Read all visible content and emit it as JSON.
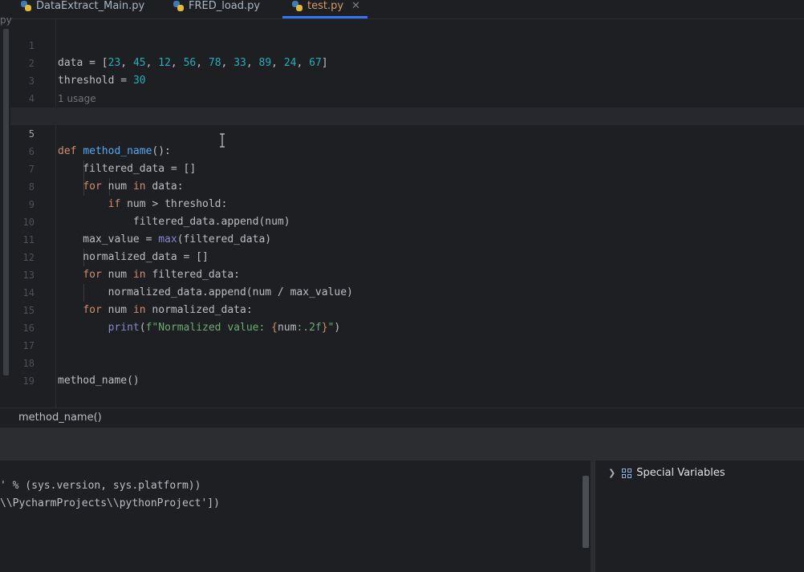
{
  "tabs": [
    {
      "label": "DataExtract_Main.py",
      "active": false
    },
    {
      "label": "FRED_load.py",
      "active": false
    },
    {
      "label": "test.py",
      "active": true
    }
  ],
  "sidebar_fragment": "py",
  "editor": {
    "usage_hint": "1 usage",
    "current_line": 5,
    "line_numbers": [
      "1",
      "2",
      "3",
      "4",
      "5",
      "6",
      "7",
      "8",
      "9",
      "10",
      "11",
      "12",
      "13",
      "14",
      "15",
      "16",
      "17",
      "18",
      "19"
    ]
  },
  "code": {
    "l1": [
      "data",
      " = [",
      "23",
      ", ",
      "45",
      ", ",
      "12",
      ", ",
      "56",
      ", ",
      "78",
      ", ",
      "33",
      ", ",
      "89",
      ", ",
      "24",
      ", ",
      "67",
      "]"
    ],
    "l2": [
      "threshold",
      " = ",
      "30"
    ],
    "l5": [
      "def",
      " ",
      "method_name",
      "():"
    ],
    "l6": "    filtered_data = []",
    "l7": [
      "    ",
      "for",
      " num ",
      "in",
      " data:"
    ],
    "l8": [
      "        ",
      "if",
      " num > threshold:"
    ],
    "l9": "            filtered_data.append(num)",
    "l10": [
      "    max_value = ",
      "max",
      "(filtered_data)"
    ],
    "l11": "    normalized_data = []",
    "l12": [
      "    ",
      "for",
      " num ",
      "in",
      " filtered_data:"
    ],
    "l13": "        normalized_data.append(num / max_value)",
    "l14": [
      "    ",
      "for",
      " num ",
      "in",
      " normalized_data:"
    ],
    "l15": [
      "        ",
      "print",
      "(",
      "f\"Normalized value: ",
      "{",
      "num",
      ":.2f",
      "}",
      "\"",
      ")"
    ],
    "l18": "method_name()"
  },
  "breadcrumb": "method_name()",
  "console": {
    "lines": [
      "' % (sys.version, sys.platform))",
      "\\\\PycharmProjects\\\\pythonProject'])"
    ]
  },
  "variables_panel": {
    "item": "Special Variables"
  },
  "colors": {
    "keyword": "#cf8e6d",
    "number": "#2aacb8",
    "function": "#56a8f5",
    "builtin": "#8888c6",
    "string": "#6aab73",
    "active_tab": "#d49c69",
    "tab_underline": "#3574f0"
  }
}
